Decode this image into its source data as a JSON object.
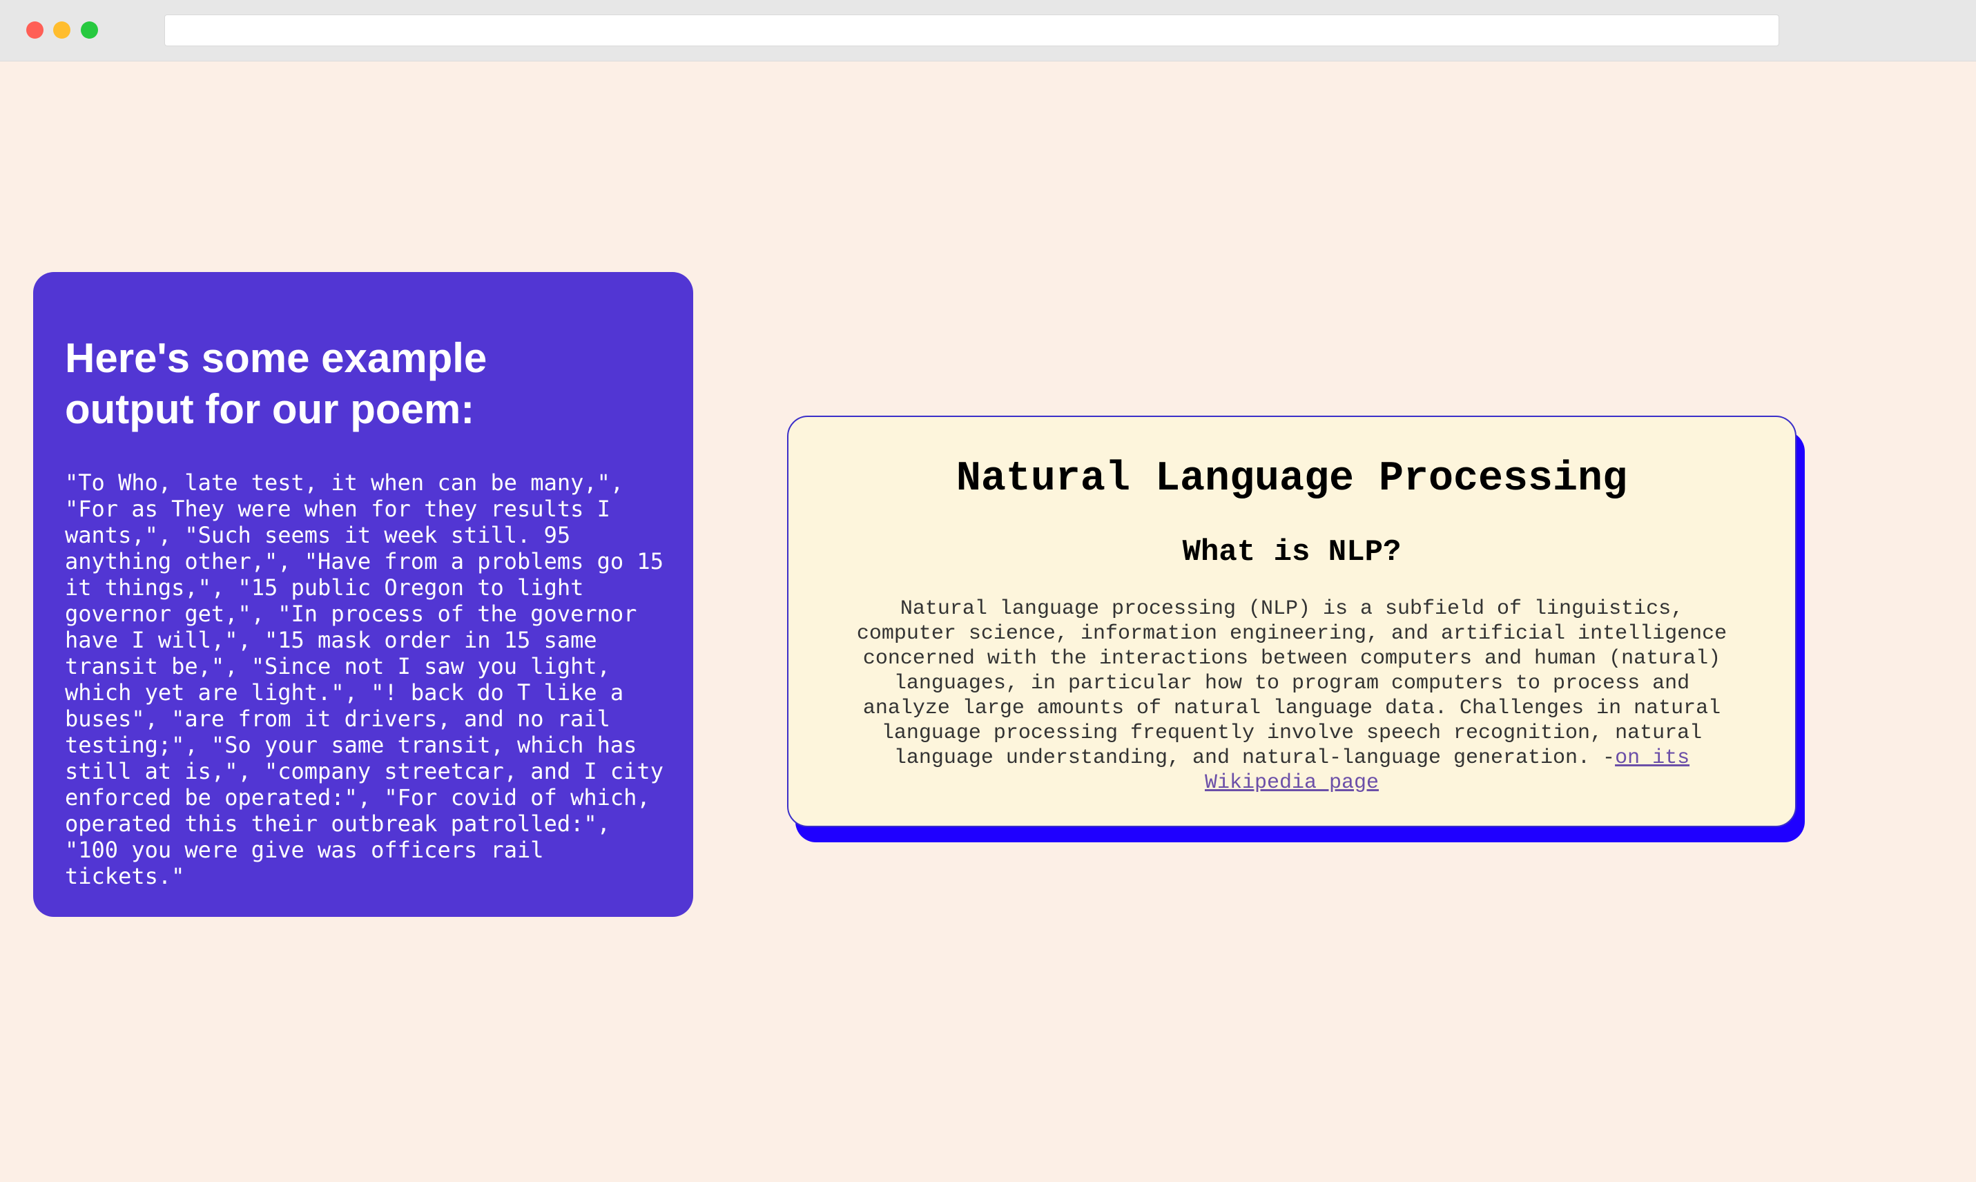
{
  "browser": {
    "address_value": ""
  },
  "poem_card": {
    "title": "Here's some example output for our poem:",
    "text": "\"To Who, late test, it when can be many,\", \"For as They were when for they results I wants,\", \"Such seems it week still. 95 anything other,\", \"Have from a problems go 15 it things,\", \"15 public Oregon to light governor get,\", \"In process of the governor have I will,\", \"15 mask order in 15 same transit be,\", \"Since not I saw you light, which yet are light.\", \"! back do T like a buses\", \"are from it drivers, and no rail testing;\", \"So your same transit, which has still at is,\", \"company streetcar, and I city enforced be operated:\", \"For covid of which, operated this their outbreak patrolled:\", \"100 you were give was officers rail tickets.\""
  },
  "nlp_card": {
    "title": "Natural Language Processing",
    "subtitle": "What is NLP?",
    "body": "Natural language processing (NLP) is a subfield of linguistics, computer science, information engineering, and artificial intelligence concerned with the interactions between computers and human (natural) languages, in particular how to program computers to process and analyze large amounts of natural language data. Challenges in natural language processing frequently involve speech recognition, natural language understanding, and natural-language generation. -",
    "link_text": "on its Wikipedia page"
  },
  "colors": {
    "page_background": "#fcefe6",
    "poem_card_background": "#5236d3",
    "nlp_card_background": "#fdf5dc",
    "nlp_card_shadow": "#1f00ff",
    "link": "#6b4fa8"
  }
}
